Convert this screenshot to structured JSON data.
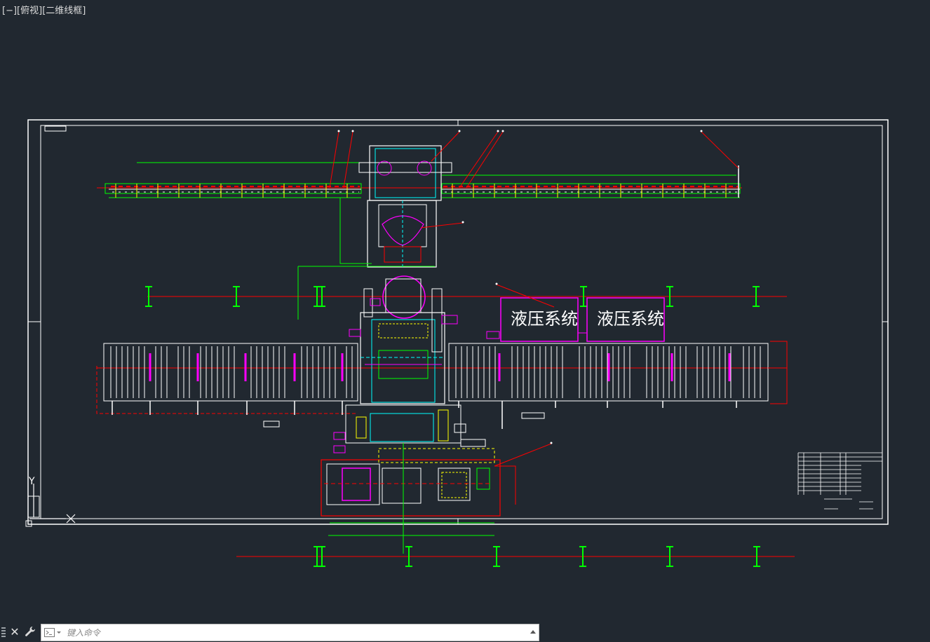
{
  "viewport": {
    "minimize": "[−]",
    "view": "[俯视]",
    "visual_style": "[二维线框]"
  },
  "drawing": {
    "hydraulic_label_1": "液压系统",
    "hydraulic_label_2": "液压系统",
    "ucs_y": "Y",
    "ucs_x": "X"
  },
  "command": {
    "placeholder": "键入命令",
    "close_icon": "close-icon",
    "settings_icon": "wrench-icon"
  },
  "colors": {
    "background": "#212830",
    "frame": "#ffffff",
    "green": "#00ff00",
    "red": "#ff0000",
    "magenta": "#ff00ff",
    "cyan": "#00ffff",
    "yellow": "#ffff00"
  }
}
